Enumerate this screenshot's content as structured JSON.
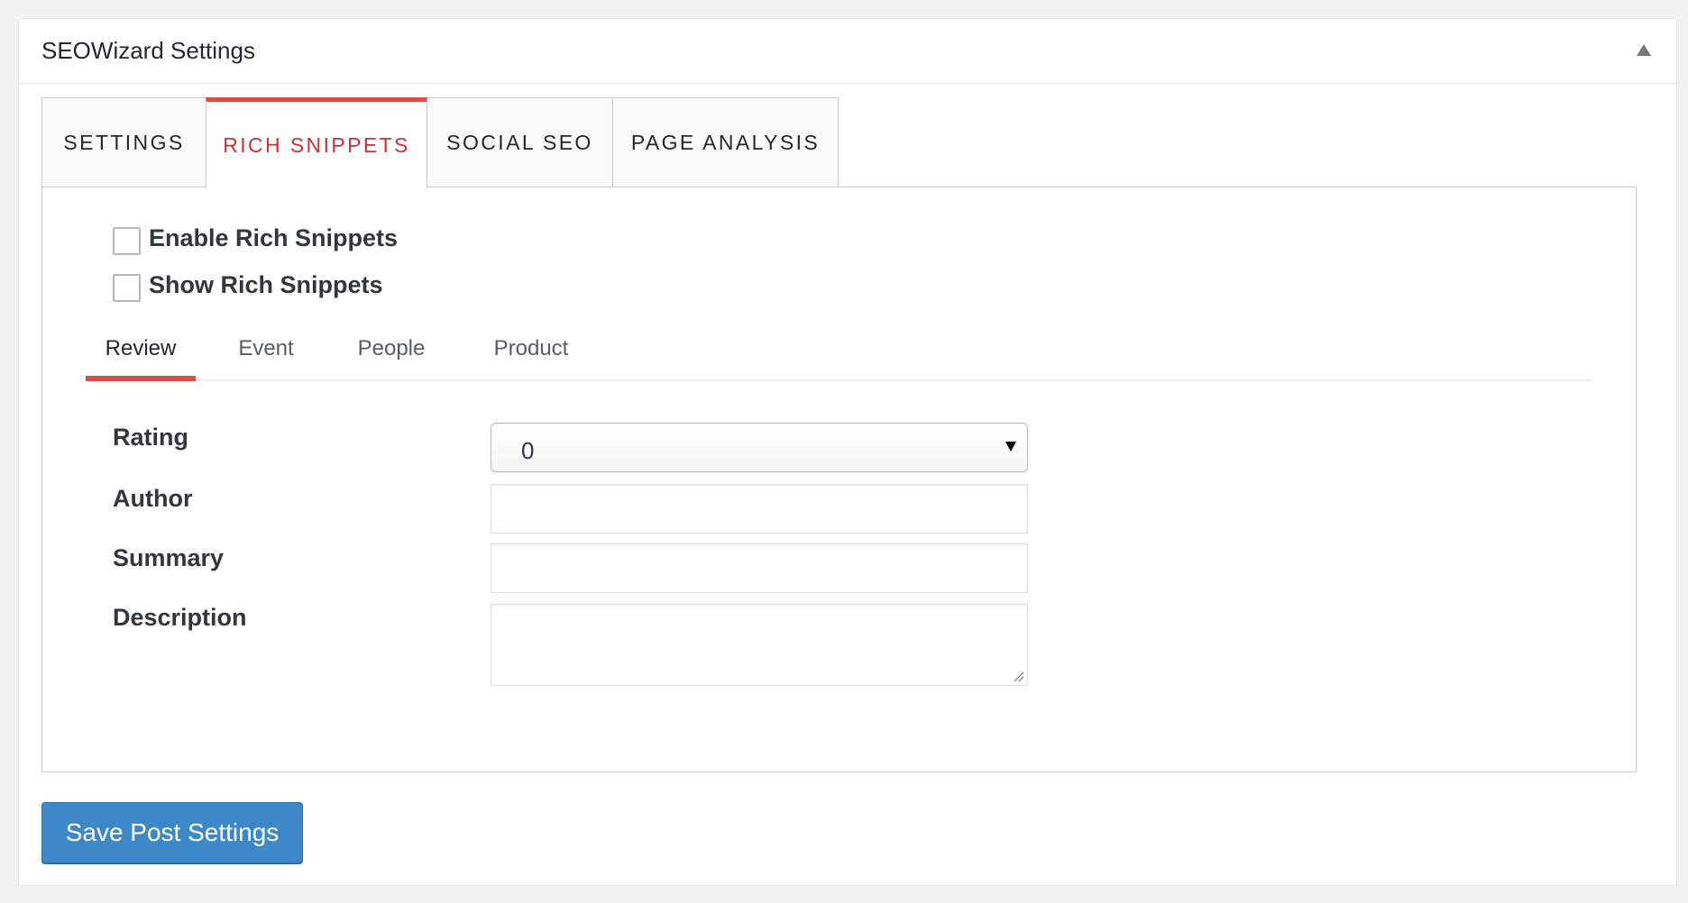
{
  "postbox": {
    "title": "SEOWizard Settings",
    "toggle_icon": "triangle-up-icon"
  },
  "main_tabs": [
    {
      "label": "SETTINGS",
      "active": false
    },
    {
      "label": "RICH SNIPPETS",
      "active": true
    },
    {
      "label": "SOCIAL SEO",
      "active": false
    },
    {
      "label": "PAGE ANALYSIS",
      "active": false
    }
  ],
  "checkboxes": [
    {
      "label": "Enable Rich Snippets",
      "checked": false
    },
    {
      "label": "Show Rich Snippets",
      "checked": false
    }
  ],
  "sub_tabs": [
    {
      "label": "Review",
      "active": true
    },
    {
      "label": "Event",
      "active": false
    },
    {
      "label": "People",
      "active": false
    },
    {
      "label": "Product",
      "active": false
    }
  ],
  "form": {
    "rating": {
      "label": "Rating",
      "value": "0"
    },
    "author": {
      "label": "Author",
      "value": ""
    },
    "summary": {
      "label": "Summary",
      "value": ""
    },
    "description": {
      "label": "Description",
      "value": ""
    }
  },
  "save_button": {
    "label": "Save Post Settings"
  },
  "colors": {
    "accent_red": "#dd4b45",
    "active_tab_text": "#c5323a",
    "button_blue": "#3c88c8"
  }
}
